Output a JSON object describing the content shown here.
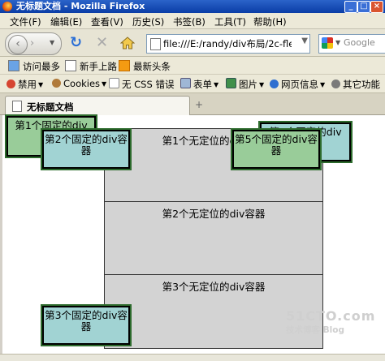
{
  "window": {
    "title": "无标题文档 - Mozilla Firefox",
    "controls": [
      "minimize",
      "maximize",
      "close"
    ]
  },
  "menu": [
    "文件(F)",
    "编辑(E)",
    "查看(V)",
    "历史(S)",
    "书签(B)",
    "工具(T)",
    "帮助(H)"
  ],
  "nav": {
    "url": "file:///E:/randy/div布局/2c-fle",
    "search_placeholder": "Google"
  },
  "bookmarks": [
    "访问最多",
    "新手上路",
    "最新头条"
  ],
  "devbar": [
    "禁用",
    "Cookies",
    "无 CSS 错误",
    "表单",
    "图片",
    "网页信息",
    "其它功能"
  ],
  "tab": {
    "title": "无标题文档",
    "new_tab": "+"
  },
  "page": {
    "static_boxes": [
      "第1个无定位的div容器",
      "第2个无定位的div容器",
      "第3个无定位的div容器"
    ],
    "fixed_boxes": [
      "第1个固定的div",
      "第2个固定的div容器",
      "第3个固定的div容器",
      "第4个固定的div",
      "第5个固定的div容器"
    ]
  },
  "watermark": {
    "line1": "51CTO.com",
    "line2": "技术博客  Blog"
  },
  "colors": {
    "fixed_fill_teal": "#a1d3d3",
    "fixed_fill_green": "#99cc99",
    "static_fill": "#d3d3d3"
  }
}
